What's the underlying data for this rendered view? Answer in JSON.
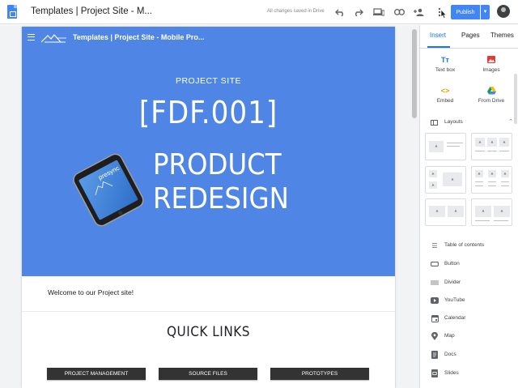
{
  "app": {
    "doc_title": "Templates | Project Site - M...",
    "save_status": "All changes saved in Drive",
    "publish_label": "Publish",
    "toolbar_icons": [
      "undo-icon",
      "redo-icon",
      "preview-icon",
      "link-icon",
      "share-icon",
      "more-icon"
    ]
  },
  "site": {
    "name": "Templates | Project Site - Mobile Pro...",
    "eyebrow": "PROJECT SITE",
    "code": "[FDF.001]",
    "headline": "PRODUCT REDESIGN",
    "phone_brand": "presync",
    "welcome": "Welcome to our Project site!",
    "quick_links_title": "QUICK LINKS",
    "quick_links": [
      "PROJECT MANAGEMENT",
      "SOURCE FILES",
      "PROTOTYPES"
    ],
    "header_color": "#4f85e4"
  },
  "panel": {
    "tabs": [
      "Insert",
      "Pages",
      "Themes"
    ],
    "active_tab": "Insert",
    "insert_items": [
      {
        "label": "Text box",
        "icon": "text-box-icon"
      },
      {
        "label": "Images",
        "icon": "image-icon"
      },
      {
        "label": "Embed",
        "icon": "embed-icon"
      },
      {
        "label": "From Drive",
        "icon": "drive-icon"
      }
    ],
    "layouts_label": "Layouts",
    "components": [
      {
        "label": "Table of contents",
        "icon": "toc-icon"
      },
      {
        "label": "Button",
        "icon": "button-icon"
      },
      {
        "label": "Divider",
        "icon": "divider-icon"
      },
      {
        "label": "YouTube",
        "icon": "youtube-icon"
      },
      {
        "label": "Calendar",
        "icon": "calendar-icon"
      },
      {
        "label": "Map",
        "icon": "map-icon"
      },
      {
        "label": "Docs",
        "icon": "docs-icon"
      },
      {
        "label": "Slides",
        "icon": "slides-icon"
      }
    ],
    "accent_color": "#1a73e8"
  }
}
